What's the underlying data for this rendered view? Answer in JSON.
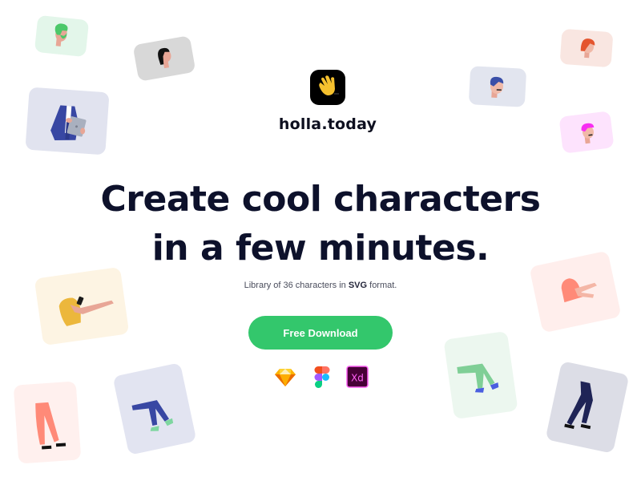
{
  "brand": {
    "name": "holla.today",
    "logo_icon": "waving-hand-icon",
    "logo_bg": "#000000",
    "logo_fg": "#f5c12e"
  },
  "hero": {
    "headline_line1": "Create cool characters",
    "headline_line2": "in a few minutes.",
    "subtitle_prefix": "Library of 36 characters in ",
    "subtitle_bold": "SVG",
    "subtitle_suffix": " format.",
    "cta_label": "Free Download",
    "cta_color": "#33c76c"
  },
  "tools": [
    {
      "name": "Sketch",
      "icon": "sketch-icon"
    },
    {
      "name": "Figma",
      "icon": "figma-icon"
    },
    {
      "name": "Adobe XD",
      "icon": "adobe-xd-icon",
      "label": "Xd"
    }
  ],
  "cards": [
    {
      "id": "green-hair-head",
      "bg": "#e3f6ea",
      "part": "head"
    },
    {
      "id": "black-hair-head",
      "bg": "#d8d8d8",
      "part": "head"
    },
    {
      "id": "suit-tablet-body",
      "bg": "#e1e3ef",
      "part": "body"
    },
    {
      "id": "red-hair-head",
      "bg": "#f9e6e1",
      "part": "head"
    },
    {
      "id": "blue-hair-head",
      "bg": "#e2e5ef",
      "part": "head"
    },
    {
      "id": "pink-hair-head",
      "bg": "#fde3fd",
      "part": "head"
    },
    {
      "id": "yellow-shirt-pointing-body",
      "bg": "#fdf4e3",
      "part": "body"
    },
    {
      "id": "coral-pants-legs",
      "bg": "#fff0ee",
      "part": "legs"
    },
    {
      "id": "blue-pants-sitting-legs",
      "bg": "#e2e4f1",
      "part": "legs"
    },
    {
      "id": "coral-shirt-pointing-body",
      "bg": "#ffeeec",
      "part": "body"
    },
    {
      "id": "green-pants-sitting-legs",
      "bg": "#ecf7ef",
      "part": "legs"
    },
    {
      "id": "navy-pants-walking-legs",
      "bg": "#dcdde6",
      "part": "legs"
    }
  ]
}
